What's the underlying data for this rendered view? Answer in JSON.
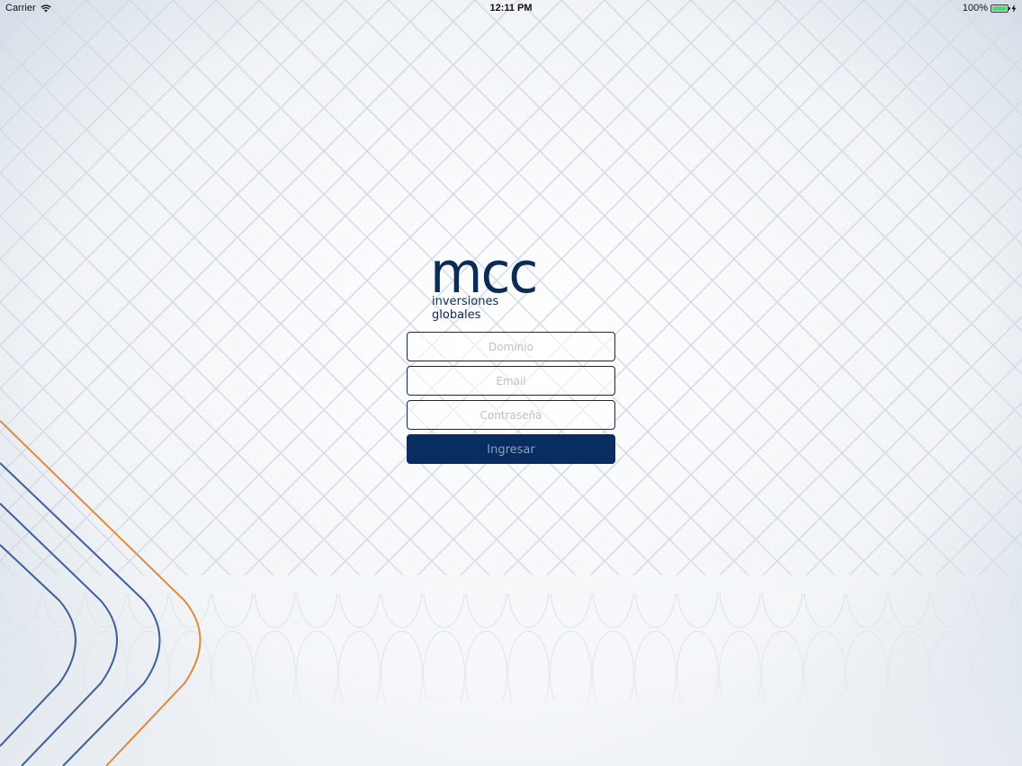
{
  "status_bar": {
    "carrier": "Carrier",
    "time": "12:11 PM",
    "battery_percent": "100%",
    "battery_level": 1.0
  },
  "logo": {
    "mark": "mcc",
    "line1": "inversiones",
    "line2": "globales"
  },
  "form": {
    "domain_placeholder": "Dominio",
    "email_placeholder": "Email",
    "password_placeholder": "Contraseña",
    "submit_label": "Ingresar"
  },
  "colors": {
    "brand_navy": "#0e2a57",
    "button_bg": "#082d5e",
    "accent_orange": "#e08a3c",
    "accent_blue": "#3d5f9a"
  },
  "icons": [
    "wifi-icon",
    "battery-icon",
    "charging-bolt-icon"
  ]
}
